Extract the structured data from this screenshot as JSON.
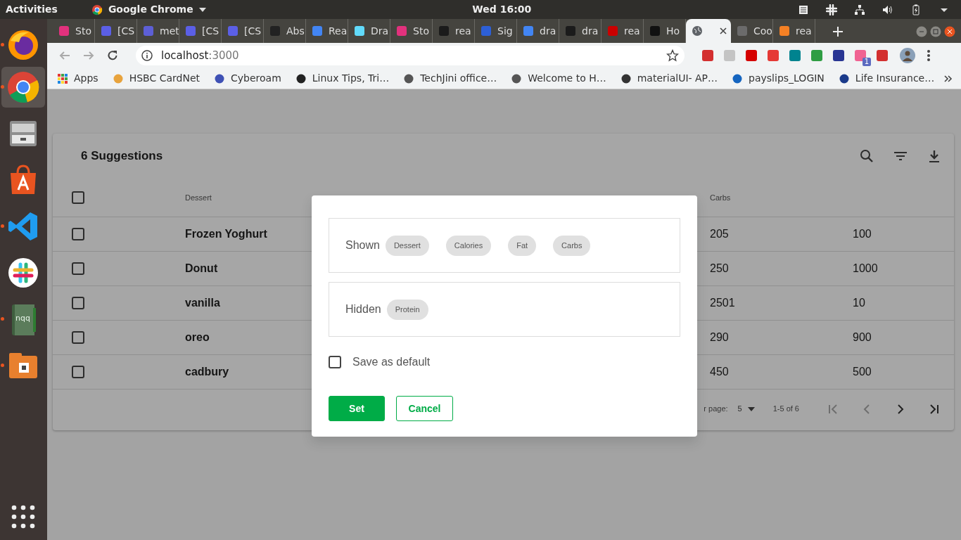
{
  "topbar": {
    "activities": "Activities",
    "app_menu": "Google Chrome",
    "clock": "Wed 16:00",
    "tray": [
      {
        "kind": "notes"
      },
      {
        "kind": "slack"
      },
      {
        "kind": "network"
      },
      {
        "kind": "volume"
      },
      {
        "kind": "battery"
      },
      {
        "kind": "caret"
      }
    ]
  },
  "dock": [
    {
      "kind": "firefox",
      "running": true,
      "selected": false
    },
    {
      "kind": "chrome",
      "running": true,
      "selected": true
    },
    {
      "kind": "files",
      "running": false,
      "selected": false
    },
    {
      "kind": "store",
      "running": false,
      "selected": false
    },
    {
      "kind": "vscode",
      "running": true,
      "selected": false
    },
    {
      "kind": "slack",
      "running": false,
      "selected": false
    },
    {
      "kind": "notebook",
      "label": "nqq",
      "running": true,
      "selected": false
    },
    {
      "kind": "archive",
      "running": true,
      "selected": false
    }
  ],
  "tabs": [
    {
      "title": "Sto",
      "color": "#e2317d",
      "selected": false
    },
    {
      "title": "[CS",
      "color": "#5b5fe6",
      "selected": false
    },
    {
      "title": "met",
      "color": "#5d5fd6",
      "selected": false
    },
    {
      "title": "[CS",
      "color": "#5b5fe6",
      "selected": false
    },
    {
      "title": "[CS",
      "color": "#5b5fe6",
      "selected": false
    },
    {
      "title": "Abs",
      "color": "#222222",
      "selected": false
    },
    {
      "title": "Rea",
      "color": "#4285f4",
      "selected": false
    },
    {
      "title": "Dra",
      "color": "#61dafb",
      "selected": false
    },
    {
      "title": "Sto",
      "color": "#e2317d",
      "selected": false
    },
    {
      "title": "rea",
      "color": "#1b1b1b",
      "selected": false
    },
    {
      "title": "Sig",
      "color": "#2d5fd6",
      "selected": false
    },
    {
      "title": "dra",
      "color": "#4285f4",
      "selected": false
    },
    {
      "title": "dra",
      "color": "#1b1b1b",
      "selected": false
    },
    {
      "title": "rea",
      "color": "#cb0000",
      "selected": false
    },
    {
      "title": "Ho",
      "color": "#111111",
      "selected": false
    },
    {
      "color": "#5f6368",
      "selected": true
    },
    {
      "title": "Coo",
      "color": "#6b6b6b",
      "selected": false
    },
    {
      "title": "rea",
      "color": "#f48024",
      "selected": false
    }
  ],
  "address": {
    "host": "localhost",
    "port": ":3000"
  },
  "extensions": [
    {
      "color": "#d32f2f"
    },
    {
      "color": "#c4c4c4"
    },
    {
      "color": "#d50000"
    },
    {
      "color": "#e53935"
    },
    {
      "color": "#00838f"
    },
    {
      "color": "#2e9d43"
    },
    {
      "color": "#283593"
    },
    {
      "color": "#f06292",
      "badge": "1"
    },
    {
      "color": "#d32f2f"
    }
  ],
  "bookmarks": [
    {
      "label": "Apps"
    },
    {
      "label": "HSBC CardNet",
      "color": "#e8a33d"
    },
    {
      "label": "Cyberoam",
      "color": "#3f51b5"
    },
    {
      "label": "Linux Tips, Tri…",
      "color": "#222222"
    },
    {
      "label": "TechJini office…",
      "color": "#555555"
    },
    {
      "label": "Welcome to H…",
      "color": "#555555"
    },
    {
      "label": "materialUI- AP…",
      "color": "#333333"
    },
    {
      "label": "payslips_LOGIN",
      "color": "#1565c0"
    },
    {
      "label": "Life Insurance…",
      "color": "#1a3a8a"
    }
  ],
  "page": {
    "title": "6 Suggestions",
    "header_checked": false,
    "columns": {
      "dessert": "Dessert",
      "carbs": "Carbs"
    },
    "rows": [
      {
        "dessert": "Frozen Yoghurt",
        "carbs": "205",
        "column_5": "100",
        "checked": false
      },
      {
        "dessert": "Donut",
        "carbs": "250",
        "column_5": "1000",
        "checked": false
      },
      {
        "dessert": "vanilla",
        "carbs": "2501",
        "column_5": "10",
        "checked": false
      },
      {
        "dessert": "oreo",
        "carbs": "290",
        "column_5": "900",
        "checked": false
      },
      {
        "dessert": "cadbury",
        "carbs": "450",
        "column_5": "500",
        "checked": false
      }
    ],
    "footer": {
      "rows_label": "r page:",
      "rows_per_page": "5",
      "range": "1-5 of 6"
    },
    "pagination": [
      {
        "kind": "first",
        "disabled": true
      },
      {
        "kind": "prev",
        "disabled": true
      },
      {
        "kind": "next",
        "disabled": false
      },
      {
        "kind": "last",
        "disabled": false
      }
    ]
  },
  "dialog": {
    "sections": [
      {
        "label": "Shown",
        "chips": [
          "Dessert",
          "Calories",
          "Fat",
          "Carbs"
        ]
      },
      {
        "label": "Hidden",
        "chips": [
          "Protein"
        ]
      }
    ],
    "save_default": {
      "label": "Save as default",
      "checked": false
    },
    "buttons": [
      {
        "label": "Set",
        "kind": "primary"
      },
      {
        "label": "Cancel",
        "kind": "outline"
      }
    ]
  }
}
